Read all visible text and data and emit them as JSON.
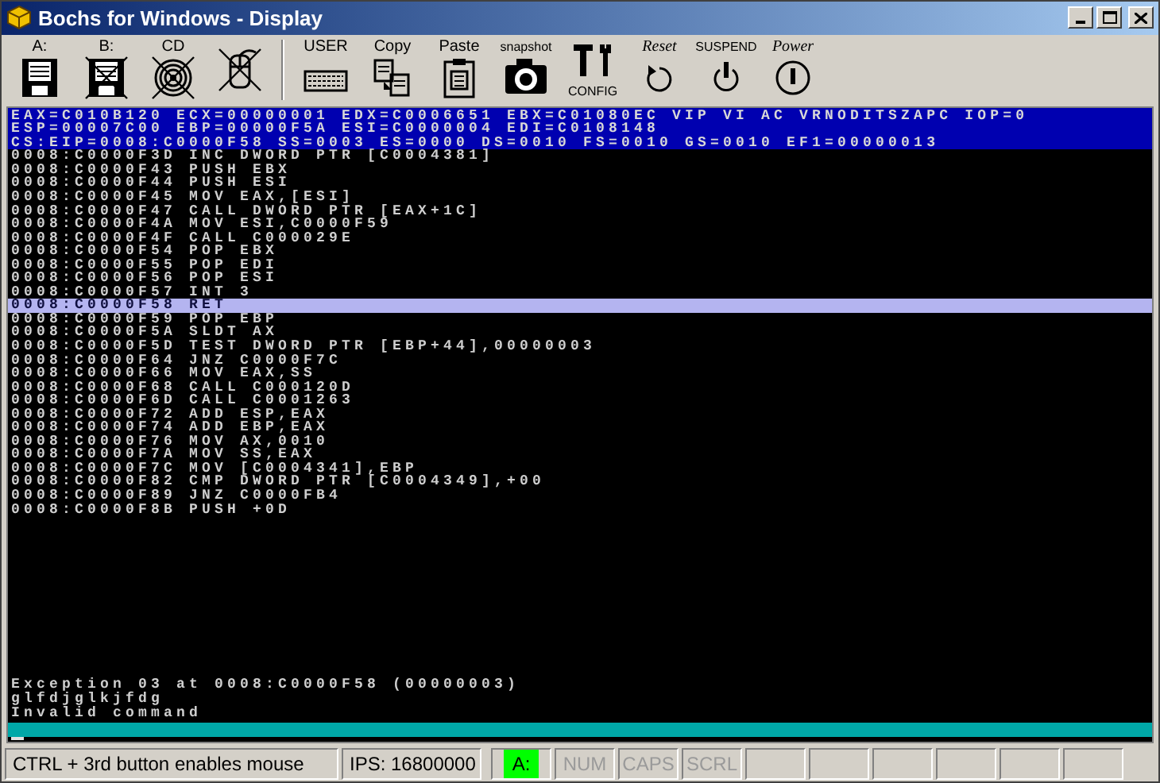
{
  "window": {
    "title": "Bochs for Windows - Display"
  },
  "device_buttons": [
    {
      "kind": "floppy",
      "label": "A:",
      "crossed": false
    },
    {
      "kind": "floppy",
      "label": "B:",
      "crossed": true
    },
    {
      "kind": "cdrom",
      "label": "CD",
      "crossed": true
    },
    {
      "kind": "mouse",
      "crossed": true
    }
  ],
  "action_buttons": [
    {
      "kind": "user",
      "label": "USER"
    },
    {
      "kind": "copy",
      "label": "Copy"
    },
    {
      "kind": "paste",
      "label": "Paste"
    },
    {
      "kind": "snapshot",
      "label": "snapshot"
    },
    {
      "kind": "config",
      "label": "CONFIG"
    },
    {
      "kind": "reset",
      "label": "Reset"
    },
    {
      "kind": "suspend",
      "label": "SUSPEND"
    },
    {
      "kind": "power",
      "label": "Power"
    }
  ],
  "registers": [
    "EAX=C010B120 ECX=00000001 EDX=C0006651 EBX=C01080EC VIP VI AC VRNODITSZAPC IOP=0",
    "ESP=00007C00 EBP=00000F5A ESI=C0000004 EDI=C0108148",
    "CS:EIP=0008:C0000F58 SS=0003 ES=0000 DS=0010 FS=0010 GS=0010 EF1=00000013"
  ],
  "disassembly": [
    {
      "address": "0008:C0000F3D",
      "instruction": "INC DWORD PTR [C0004381]",
      "selected": false
    },
    {
      "address": "0008:C0000F43",
      "instruction": "PUSH EBX",
      "selected": false
    },
    {
      "address": "0008:C0000F44",
      "instruction": "PUSH ESI",
      "selected": false
    },
    {
      "address": "0008:C0000F45",
      "instruction": "MOV EAX,[ESI]",
      "selected": false
    },
    {
      "address": "0008:C0000F47",
      "instruction": "CALL DWORD PTR [EAX+1C]",
      "selected": false
    },
    {
      "address": "0008:C0000F4A",
      "instruction": "MOV ESI,C0000F59",
      "selected": false
    },
    {
      "address": "0008:C0000F4F",
      "instruction": "CALL C000029E",
      "selected": false
    },
    {
      "address": "0008:C0000F54",
      "instruction": "POP EBX",
      "selected": false
    },
    {
      "address": "0008:C0000F55",
      "instruction": "POP EDI",
      "selected": false
    },
    {
      "address": "0008:C0000F56",
      "instruction": "POP ESI",
      "selected": false
    },
    {
      "address": "0008:C0000F57",
      "instruction": "INT 3",
      "selected": false
    },
    {
      "address": "0008:C0000F58",
      "instruction": "RET",
      "selected": true
    },
    {
      "address": "0008:C0000F59",
      "instruction": "POP EBP",
      "selected": false
    },
    {
      "address": "0008:C0000F5A",
      "instruction": "SLDT AX",
      "selected": false
    },
    {
      "address": "0008:C0000F5D",
      "instruction": "TEST DWORD PTR [EBP+44],00000003",
      "selected": false
    },
    {
      "address": "0008:C0000F64",
      "instruction": "JNZ C0000F7C",
      "selected": false
    },
    {
      "address": "0008:C0000F66",
      "instruction": "MOV EAX,SS",
      "selected": false
    },
    {
      "address": "0008:C0000F68",
      "instruction": "CALL C000120D",
      "selected": false
    },
    {
      "address": "0008:C0000F6D",
      "instruction": "CALL C0001263",
      "selected": false
    },
    {
      "address": "0008:C0000F72",
      "instruction": "ADD ESP,EAX",
      "selected": false
    },
    {
      "address": "0008:C0000F74",
      "instruction": "ADD EBP,EAX",
      "selected": false
    },
    {
      "address": "0008:C0000F76",
      "instruction": "MOV AX,0010",
      "selected": false
    },
    {
      "address": "0008:C0000F7A",
      "instruction": "MOV SS,EAX",
      "selected": false
    },
    {
      "address": "0008:C0000F7C",
      "instruction": "MOV [C0004341],EBP",
      "selected": false
    },
    {
      "address": "0008:C0000F82",
      "instruction": "CMP DWORD PTR [C0004349],+00",
      "selected": false
    },
    {
      "address": "0008:C0000F89",
      "instruction": "JNZ C0000FB4",
      "selected": false
    },
    {
      "address": "0008:C0000F8B",
      "instruction": "PUSH +0D",
      "selected": false
    }
  ],
  "messages": [
    "Exception 03 at 0008:C0000F58 (00000003)",
    "glfdjglkjfdg",
    "Invalid command"
  ],
  "status_bar": [
    {
      "kind": "text",
      "text": "CTRL + 3rd button enables mouse"
    },
    {
      "kind": "text",
      "text": "IPS:  16800000"
    },
    {
      "kind": "indicator",
      "text": "A:",
      "on": true
    },
    {
      "kind": "indicator",
      "text": "NUM",
      "on": false
    },
    {
      "kind": "indicator",
      "text": "CAPS",
      "on": false
    },
    {
      "kind": "indicator",
      "text": "SCRL",
      "on": false
    }
  ]
}
